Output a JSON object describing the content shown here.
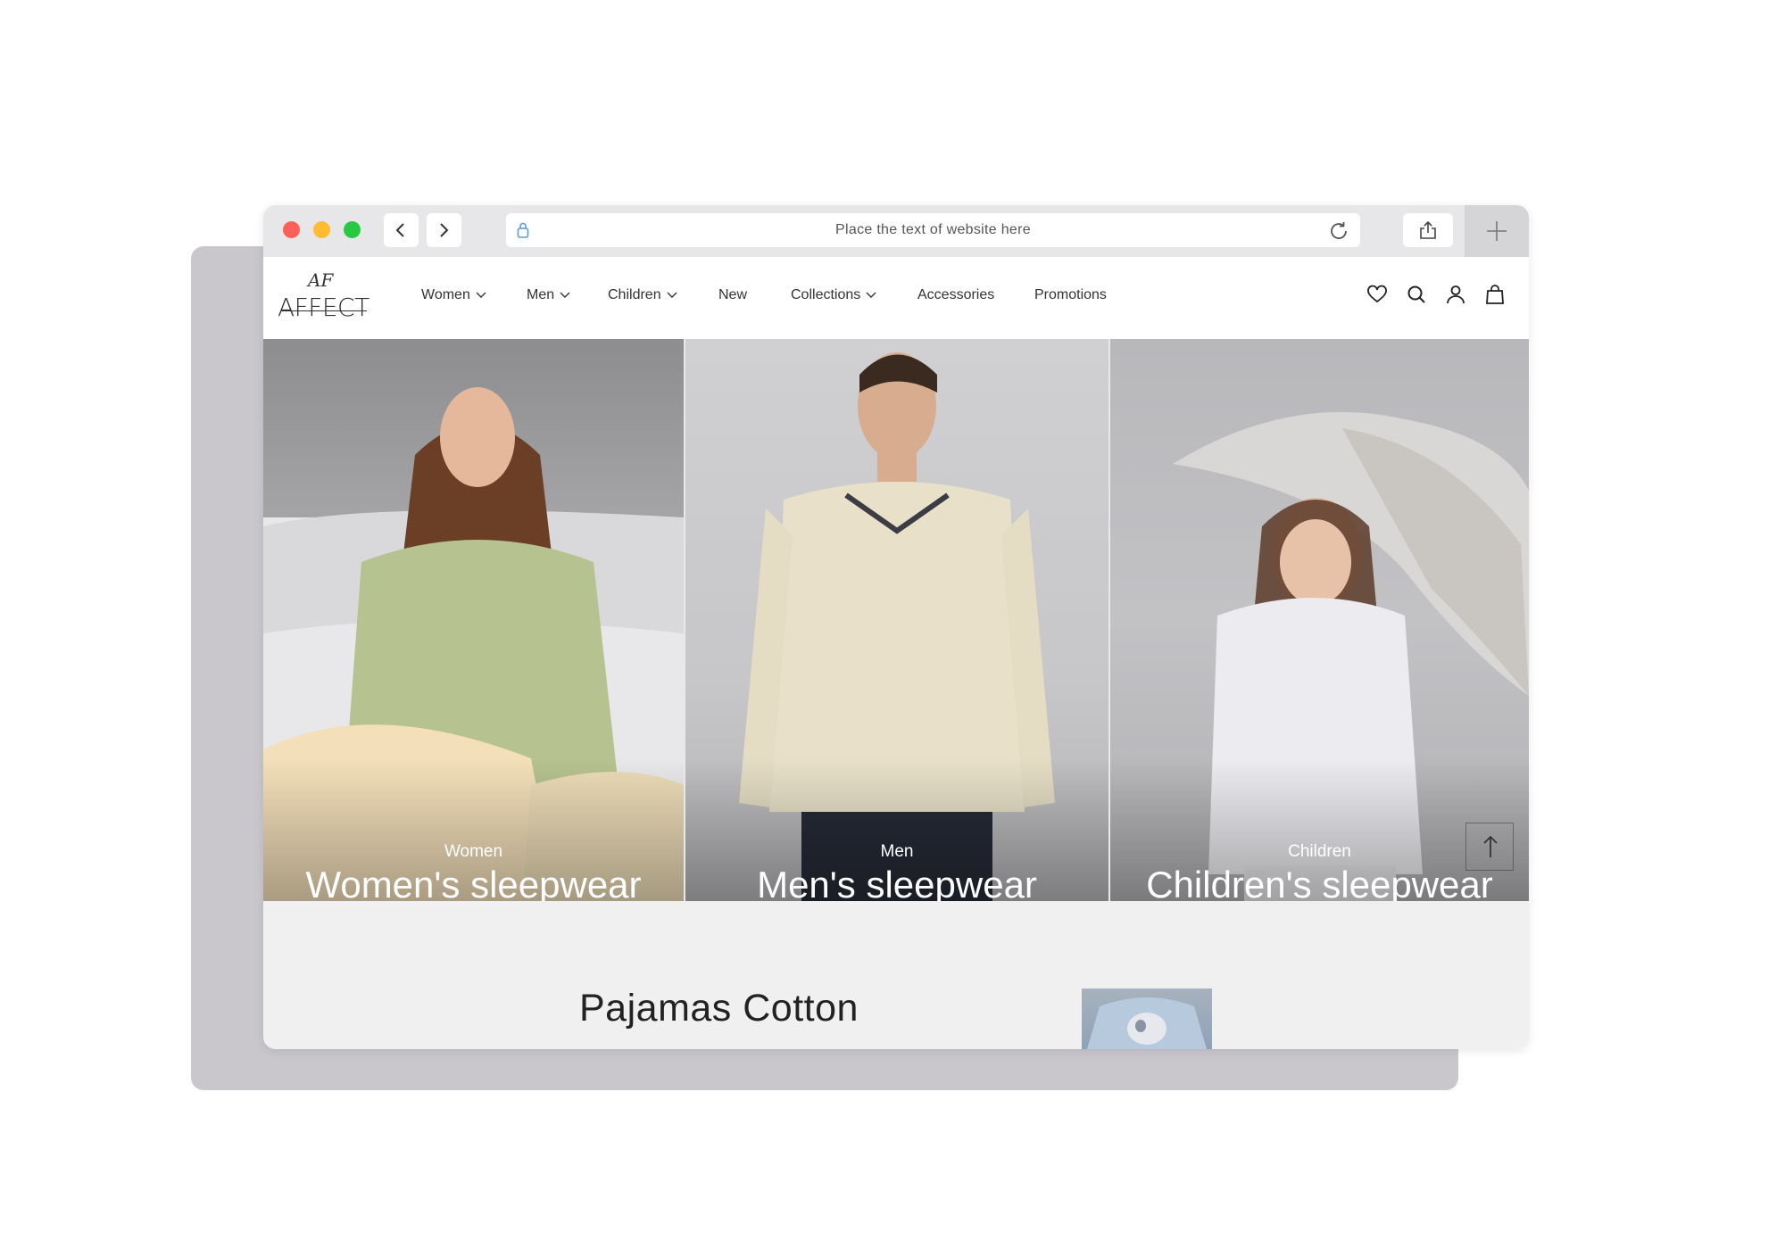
{
  "browser": {
    "url_placeholder": "Place the text of website here"
  },
  "site": {
    "logo_monogram": "AF",
    "logo_text": "AFFECT",
    "nav": [
      {
        "label": "Women",
        "has_dropdown": true
      },
      {
        "label": "Men",
        "has_dropdown": true
      },
      {
        "label": "Children",
        "has_dropdown": true
      },
      {
        "label": "New",
        "has_dropdown": false
      },
      {
        "label": "Collections",
        "has_dropdown": true
      },
      {
        "label": "Accessories",
        "has_dropdown": false
      },
      {
        "label": "Promotions",
        "has_dropdown": false
      }
    ],
    "header_icons": [
      "heart-icon",
      "search-icon",
      "user-icon",
      "shopping-bag-icon"
    ]
  },
  "hero": {
    "panels": [
      {
        "category": "Women",
        "title": "Women's sleepwear"
      },
      {
        "category": "Men",
        "title": "Men's sleepwear"
      },
      {
        "category": "Children",
        "title": "Children's sleepwear"
      }
    ]
  },
  "section": {
    "title": "Pajamas Cotton"
  },
  "colors": {
    "traffic_red": "#fe5f57",
    "traffic_yellow": "#febc2e",
    "traffic_green": "#28c840",
    "back_card": "#c9c7cc"
  }
}
